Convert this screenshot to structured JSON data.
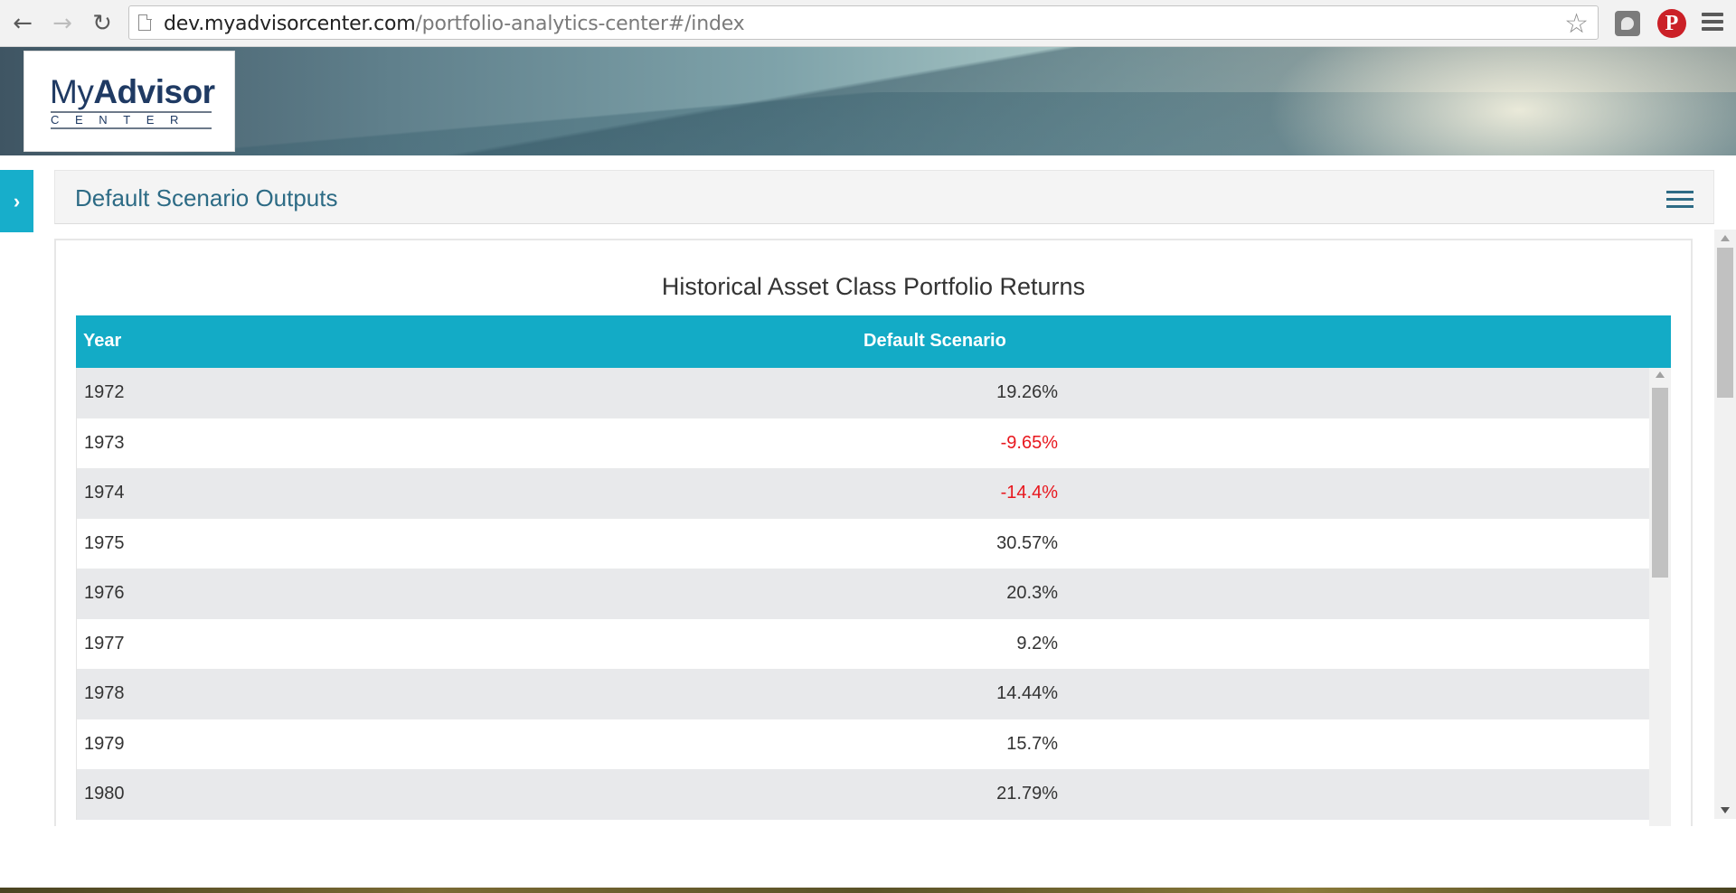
{
  "browser": {
    "url_host": "dev.myadvisorcenter.com",
    "url_path": "/portfolio-analytics-center#/index",
    "icons": {
      "back": "arrow-left-icon",
      "forward": "arrow-right-icon",
      "reload": "reload-icon",
      "page": "page-icon",
      "bookmark": "star-icon",
      "extension": "extension-icon",
      "pinterest": "pinterest-icon",
      "menu": "menu-icon"
    }
  },
  "logo": {
    "brand_my": "My",
    "brand_advisor": "Advisor",
    "brand_sub": "CENTER"
  },
  "panel": {
    "title": "Default Scenario Outputs",
    "table_title": "Historical Asset Class Portfolio Returns",
    "columns": [
      "Year",
      "Default Scenario"
    ],
    "rows": [
      {
        "year": "1972",
        "value": "19.26%"
      },
      {
        "year": "1973",
        "value": "-9.65%"
      },
      {
        "year": "1974",
        "value": "-14.4%"
      },
      {
        "year": "1975",
        "value": "30.57%"
      },
      {
        "year": "1976",
        "value": "20.3%"
      },
      {
        "year": "1977",
        "value": "9.2%"
      },
      {
        "year": "1978",
        "value": "14.44%"
      },
      {
        "year": "1979",
        "value": "15.7%"
      },
      {
        "year": "1980",
        "value": "21.79%"
      }
    ]
  },
  "colors": {
    "accent": "#13abc6",
    "title_text": "#2d6b85",
    "negative": "#e8171e"
  }
}
